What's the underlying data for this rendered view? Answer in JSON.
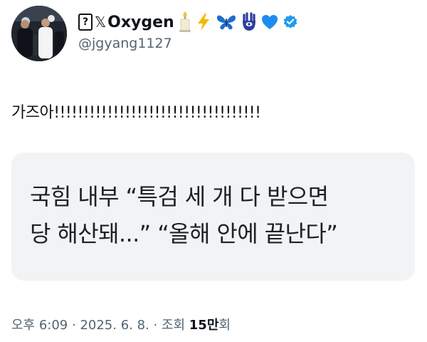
{
  "author": {
    "name_prefix_box": "?",
    "name_prefix_x": "𝕏",
    "name": "Oxygen",
    "handle": "@jgyang1127",
    "emojis": [
      "candle-icon",
      "lightning-icon",
      "butterfly-icon",
      "hamsa-icon",
      "blue-heart-icon",
      "verified-badge-icon"
    ]
  },
  "tweet": {
    "text": "가즈아!!!!!!!!!!!!!!!!!!!!!!!!!!!!!!!!!!!"
  },
  "quote_card": {
    "line1": "국힘 내부 “특검 세 개 다 받으면",
    "line2": "당 해산돼...” “올해 안에 끝난다”"
  },
  "meta": {
    "time": "오후 6:09",
    "sep1": " · ",
    "date": "2025. 6. 8.",
    "sep2": " · ",
    "views_label": "조회 ",
    "views_count": "15만",
    "views_suffix": "회"
  },
  "colors": {
    "verified": "#1d9bf0",
    "secondary_text": "#536471",
    "card_background": "#f2f3f5",
    "lightning": "#f5b800",
    "butterfly": "#1c6dd0",
    "hamsa": "#2b3f9e",
    "heart": "#1d8cf0"
  }
}
